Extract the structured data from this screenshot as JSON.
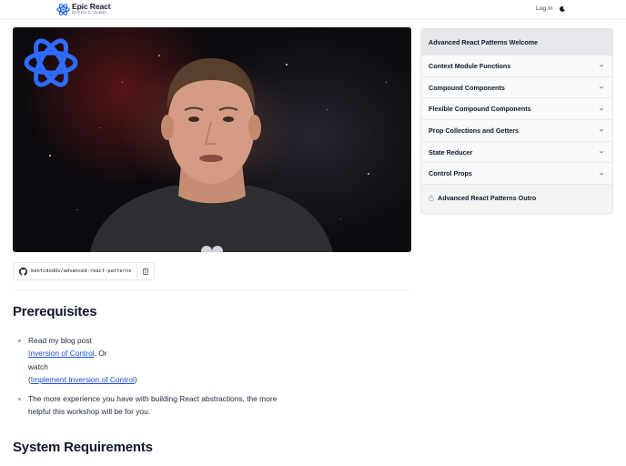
{
  "header": {
    "logo_title": "Epic React",
    "logo_subtitle": "by Kent C. Dodds",
    "login_label": "Log in",
    "theme_icon": "moon-icon"
  },
  "repo": {
    "path": "kentcdodds/advanced-react-patterns",
    "github_icon": "github-icon",
    "copy_icon": "clipboard-icon"
  },
  "content": {
    "prereq_heading": "Prerequisites",
    "item1_text1": "Read my blog post",
    "item1_link1": "Inversion of Control",
    "item1_text2": ". Or",
    "item1_text3": "watch",
    "item1_link2": "Implement Inversion of Control",
    "item1_text4": ")",
    "item1_paren": "(",
    "item2_line1": "The more experience you have with building React abstractions, the more",
    "item2_line2": "helpful this workshop will be for you.",
    "sysreq_heading": "System Requirements"
  },
  "sidebar": {
    "title": "Advanced React Patterns Welcome",
    "items": [
      {
        "label": "Context Module Functions"
      },
      {
        "label": "Compound Components"
      },
      {
        "label": "Flexible Compound Components"
      },
      {
        "label": "Prop Collections and Getters"
      },
      {
        "label": "State Reducer"
      },
      {
        "label": "Control Props"
      }
    ],
    "outro": "Advanced React Patterns Outro"
  },
  "colors": {
    "accent_link": "#1d4ed8",
    "logo_blue": "#2563eb"
  }
}
